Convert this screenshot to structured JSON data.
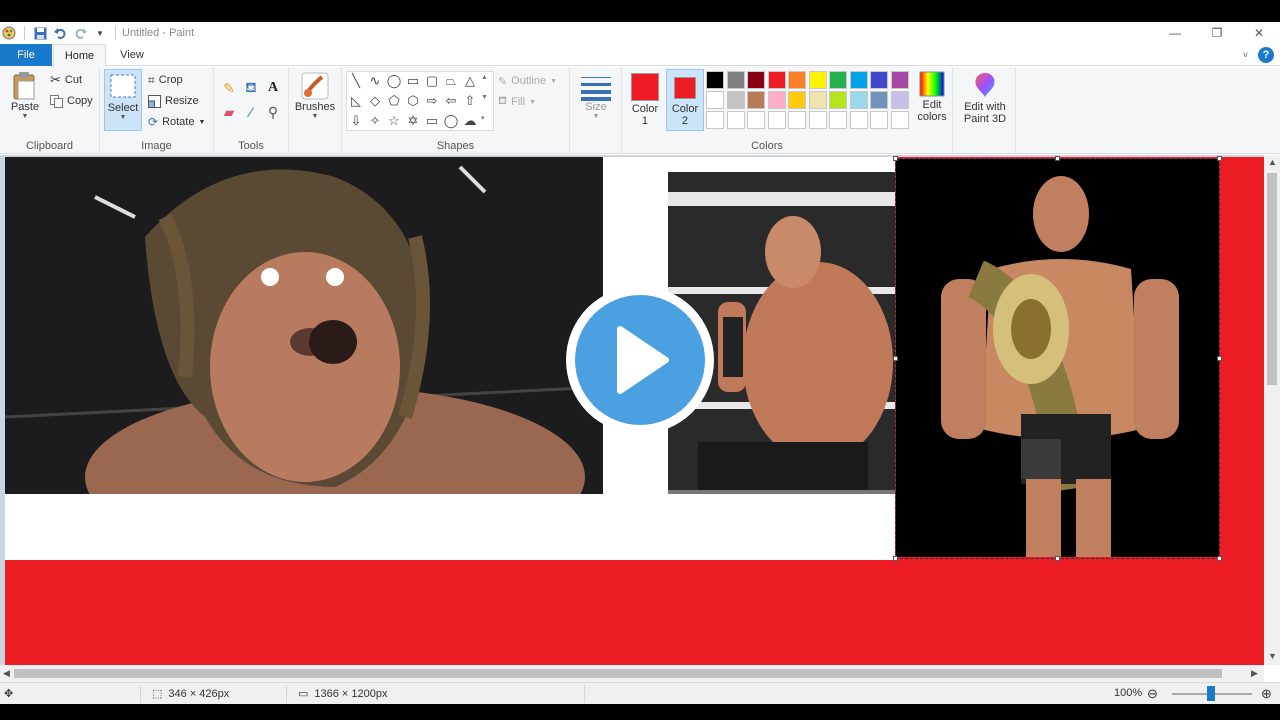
{
  "window": {
    "title": "Untitled - Paint",
    "controls": [
      "—",
      "❐",
      "✕"
    ]
  },
  "tabs": [
    "File",
    "Home",
    "View"
  ],
  "ribbon": {
    "clipboard": {
      "group_label": "Clipboard",
      "paste": "Paste",
      "cut": "Cut",
      "copy": "Copy"
    },
    "image": {
      "group_label": "Image",
      "select": "Select",
      "crop": "Crop",
      "resize": "Resize",
      "rotate": "Rotate"
    },
    "tools": {
      "group_label": "Tools"
    },
    "brushes": {
      "label": "Brushes"
    },
    "shapes": {
      "group_label": "Shapes",
      "outline": "Outline",
      "fill": "Fill"
    },
    "size": {
      "label": "Size"
    },
    "colors": {
      "group_label": "Colors",
      "color1_label": "Color\n1",
      "color2_label": "Color\n2",
      "color1": "#ed1c24",
      "color2": "#ed1c24",
      "edit_colors": "Edit colors",
      "edit_paint3d": "Edit with Paint 3D",
      "palette_row1": [
        "#000000",
        "#7f7f7f",
        "#880015",
        "#ed1c24",
        "#ff7f27",
        "#fff200",
        "#22b14c",
        "#00a2e8",
        "#3f48cc",
        "#a349a4"
      ],
      "palette_row2": [
        "#ffffff",
        "#c3c3c3",
        "#b97a57",
        "#ffaec9",
        "#ffc90e",
        "#efe4b0",
        "#b5e61d",
        "#99d9ea",
        "#7092be",
        "#c8bfe7"
      ],
      "palette_row3": [
        "#ffffff",
        "#ffffff",
        "#ffffff",
        "#ffffff",
        "#ffffff",
        "#ffffff",
        "#ffffff",
        "#ffffff",
        "#ffffff",
        "#ffffff"
      ]
    }
  },
  "canvas": {
    "background_color": "#ec1c24"
  },
  "status": {
    "selection_size": "346 × 426px",
    "image_size": "1366 × 1200px",
    "zoom": "100%"
  }
}
